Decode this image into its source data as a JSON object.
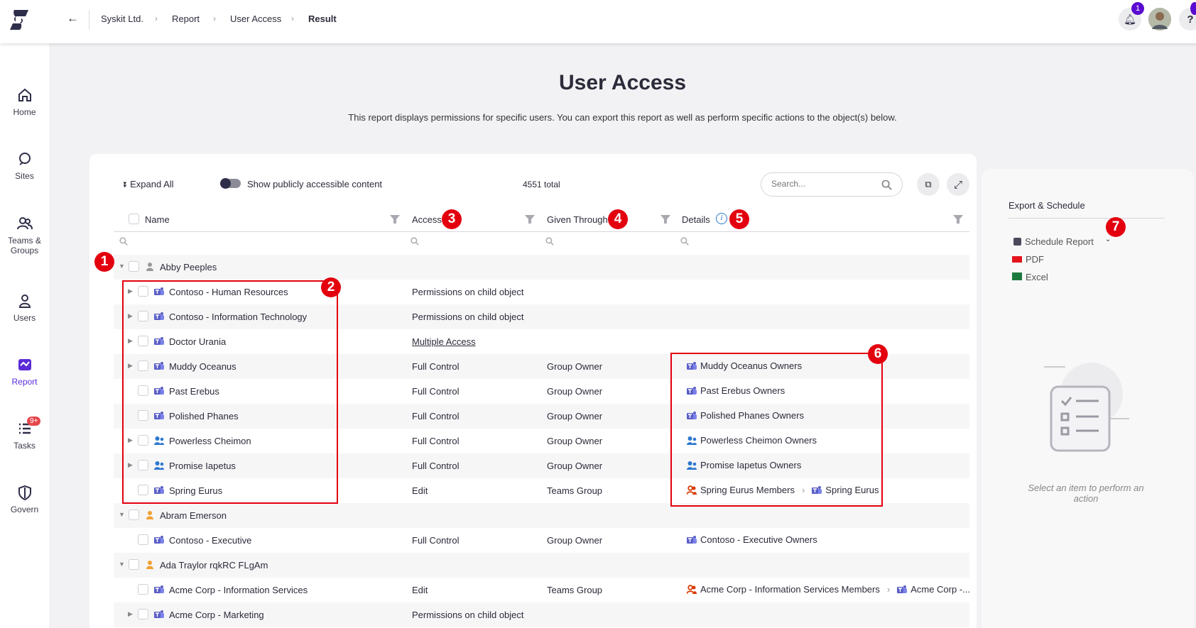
{
  "breadcrumb": [
    "Syskit Ltd.",
    "Report",
    "User Access",
    "Result"
  ],
  "notifications_count": "1",
  "sidebar": [
    {
      "label": "Home",
      "icon": "home-icon"
    },
    {
      "label": "Sites",
      "icon": "sites-icon"
    },
    {
      "label": "Teams &\nGroups",
      "icon": "teams-groups-icon"
    },
    {
      "label": "Users",
      "icon": "users-icon"
    },
    {
      "label": "Report",
      "icon": "report-icon"
    },
    {
      "label": "Tasks",
      "icon": "tasks-icon",
      "badge": "9+"
    },
    {
      "label": "Govern",
      "icon": "govern-icon"
    }
  ],
  "page": {
    "title": "User Access",
    "description": "This report displays permissions for specific users. You can export this report as well as perform specific actions to the object(s) below."
  },
  "toolbar": {
    "expand_all": "Expand All",
    "toggle_label": "Show publicly accessible content",
    "total": "4551 total",
    "search_placeholder": "Search..."
  },
  "columns": {
    "name": "Name",
    "access": "Access",
    "given": "Given Through",
    "details": "Details"
  },
  "annotations": [
    "1",
    "2",
    "3",
    "4",
    "5",
    "6",
    "7"
  ],
  "rows": [
    {
      "level": 0,
      "expanded": true,
      "icon": "user-gray",
      "name": "Abby Peeples",
      "access": "",
      "given": "",
      "details": []
    },
    {
      "level": 1,
      "chev": true,
      "icon": "teams",
      "name": "Contoso - Human Resources",
      "access": "Permissions on child object",
      "given": "",
      "details": []
    },
    {
      "level": 1,
      "chev": true,
      "icon": "teams",
      "name": "Contoso - Information Technology",
      "access": "Permissions on child object",
      "given": "",
      "details": []
    },
    {
      "level": 1,
      "chev": true,
      "icon": "teams",
      "name": "Doctor Urania",
      "access": "Multiple Access",
      "link": true,
      "given": "",
      "details": []
    },
    {
      "level": 1,
      "chev": true,
      "icon": "teams",
      "name": "Muddy Oceanus",
      "access": "Full Control",
      "given": "Group Owner",
      "details": [
        {
          "icon": "teams",
          "text": "Muddy Oceanus Owners"
        }
      ]
    },
    {
      "level": 1,
      "chev": false,
      "icon": "teams",
      "name": "Past Erebus",
      "access": "Full Control",
      "given": "Group Owner",
      "details": [
        {
          "icon": "teams",
          "text": "Past Erebus Owners"
        }
      ]
    },
    {
      "level": 1,
      "chev": false,
      "icon": "teams",
      "name": "Polished Phanes",
      "access": "Full Control",
      "given": "Group Owner",
      "details": [
        {
          "icon": "teams",
          "text": "Polished Phanes Owners"
        }
      ]
    },
    {
      "level": 1,
      "chev": true,
      "icon": "group",
      "name": "Powerless Cheimon",
      "access": "Full Control",
      "given": "Group Owner",
      "details": [
        {
          "icon": "group",
          "text": "Powerless Cheimon Owners"
        }
      ]
    },
    {
      "level": 1,
      "chev": true,
      "icon": "group",
      "name": "Promise Iapetus",
      "access": "Full Control",
      "given": "Group Owner",
      "details": [
        {
          "icon": "group",
          "text": "Promise Iapetus Owners"
        }
      ]
    },
    {
      "level": 1,
      "chev": false,
      "icon": "teams",
      "name": "Spring Eurus",
      "access": "Edit",
      "given": "Teams Group",
      "details": [
        {
          "icon": "members",
          "text": "Spring Eurus Members"
        },
        {
          "icon": "teams",
          "text": "Spring Eurus"
        }
      ]
    },
    {
      "level": 0,
      "expanded": true,
      "icon": "user-orange",
      "name": "Abram Emerson",
      "access": "",
      "given": "",
      "details": []
    },
    {
      "level": 1,
      "chev": false,
      "icon": "teams",
      "name": "Contoso - Executive",
      "access": "Full Control",
      "given": "Group Owner",
      "details": [
        {
          "icon": "teams",
          "text": "Contoso - Executive Owners"
        }
      ]
    },
    {
      "level": 0,
      "expanded": true,
      "icon": "user-orange",
      "name": "Ada Traylor rqkRC FLgAm",
      "access": "",
      "given": "",
      "details": []
    },
    {
      "level": 1,
      "chev": false,
      "icon": "teams",
      "name": "Acme Corp - Information Services",
      "access": "Edit",
      "given": "Teams Group",
      "details": [
        {
          "icon": "members",
          "text": "Acme Corp - Information Services Members"
        },
        {
          "icon": "teams",
          "text": "Acme Corp -..."
        }
      ]
    },
    {
      "level": 1,
      "chev": true,
      "icon": "teams",
      "name": "Acme Corp - Marketing",
      "access": "Permissions on child object",
      "given": "",
      "details": []
    }
  ],
  "panel": {
    "title": "Export & Schedule",
    "items": [
      "Schedule Report",
      "PDF",
      "Excel"
    ],
    "empty_text": "Select an item to perform an action"
  },
  "colors": {
    "accent": "#5a2bd6",
    "teams": "#5b5fc7",
    "group": "#2b78d0",
    "members": "#d83b01",
    "annotation": "#e3000f"
  }
}
